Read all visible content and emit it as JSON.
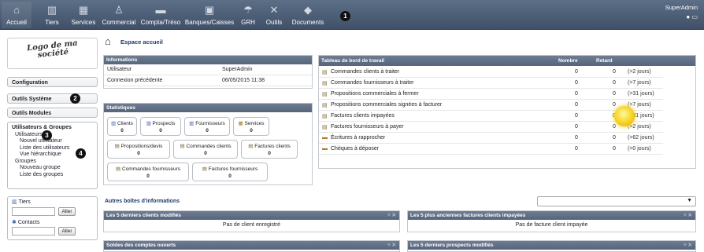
{
  "topmenu": {
    "items": [
      {
        "label": "Accueil",
        "icon": "home-icon"
      },
      {
        "label": "Tiers",
        "icon": "building-icon"
      },
      {
        "label": "Services",
        "icon": "boxes-icon"
      },
      {
        "label": "Commercial",
        "icon": "person-icon"
      },
      {
        "label": "Compta/Tréso",
        "icon": "money-icon"
      },
      {
        "label": "Banques/Caisses",
        "icon": "safe-icon"
      },
      {
        "label": "GRH",
        "icon": "umbrella-icon"
      },
      {
        "label": "Outils",
        "icon": "tools-icon"
      },
      {
        "label": "Documents",
        "icon": "folder-icon"
      }
    ],
    "user": "SuperAdmin"
  },
  "annotations": [
    "1",
    "2",
    "3",
    "4"
  ],
  "left": {
    "logo_text": "Logo de ma société",
    "configuration": "Configuration",
    "outils_systeme": "Outils Système",
    "outils_modules": "Outils Modules",
    "users": {
      "header": "Utilisateurs & Groupes",
      "utilisateurs": "Utilisateurs",
      "nouvel": "Nouvel utilisateur",
      "liste": "Liste des utilisateurs",
      "vue": "Vue hiérarchique",
      "groupes": "Groupes",
      "nouveau_groupe": "Nouveau groupe",
      "liste_groupes": "Liste des groupes"
    },
    "search": {
      "tiers_label": "Tiers",
      "contacts_label": "Contacts",
      "button": "Aller"
    }
  },
  "main": {
    "page_title": "Espace accueil",
    "info": {
      "title": "Informations",
      "rows": [
        {
          "label": "Utilisateur",
          "value": "SuperAdmin"
        },
        {
          "label": "Connexion précédente",
          "value": "06/05/2015 11:38"
        }
      ]
    },
    "stats": {
      "title": "Statistiques",
      "items": [
        {
          "label": "Clients",
          "value": "0"
        },
        {
          "label": "Prospects",
          "value": "0"
        },
        {
          "label": "Fournisseurs",
          "value": "0"
        },
        {
          "label": "Services",
          "value": "0"
        },
        {
          "label": "Propositions/devis",
          "value": "0"
        },
        {
          "label": "Commandes clients",
          "value": "0"
        },
        {
          "label": "Factures clients",
          "value": "0"
        },
        {
          "label": "Commandes fournisseurs",
          "value": "0"
        },
        {
          "label": "Factures fournisseurs",
          "value": "0"
        }
      ]
    },
    "dashboard": {
      "title": "Tableau de bord de travail",
      "col_nombre": "Nombre",
      "col_retard": "Retard",
      "rows": [
        {
          "label": "Commandes clients à traiter",
          "nombre": "0",
          "retard": "0",
          "delay": "(>2 jours)"
        },
        {
          "label": "Commandes fournisseurs à traiter",
          "nombre": "0",
          "retard": "0",
          "delay": "(>7 jours)"
        },
        {
          "label": "Propositions commerciales à fermer",
          "nombre": "0",
          "retard": "0",
          "delay": "(>31 jours)"
        },
        {
          "label": "Propositions commerciales signées à facturer",
          "nombre": "0",
          "retard": "0",
          "delay": "(>7 jours)"
        },
        {
          "label": "Factures clients impayées",
          "nombre": "0",
          "retard": "0",
          "delay": "(>31 jours)"
        },
        {
          "label": "Factures fournisseurs à payer",
          "nombre": "0",
          "retard": "0",
          "delay": "(>2 jours)"
        },
        {
          "label": "Écritures à rapprocher",
          "nombre": "0",
          "retard": "0",
          "delay": "(>62 jours)"
        },
        {
          "label": "Chèques à déposer",
          "nombre": "0",
          "retard": "0",
          "delay": "(>0 jours)"
        }
      ]
    },
    "other_boxes_title": "Autres boîtes d'informations",
    "boxes": [
      {
        "title": "Les 5 derniers clients modifiés",
        "content": "Pas de client enregistré"
      },
      {
        "title": "Les 5 plus anciennes factures clients impayées",
        "content": "Pas de facture client impayée"
      },
      {
        "title": "Soldes des comptes ouverts",
        "content": ""
      },
      {
        "title": "Les 5 derniers prospects modifiés",
        "content": ""
      }
    ]
  }
}
